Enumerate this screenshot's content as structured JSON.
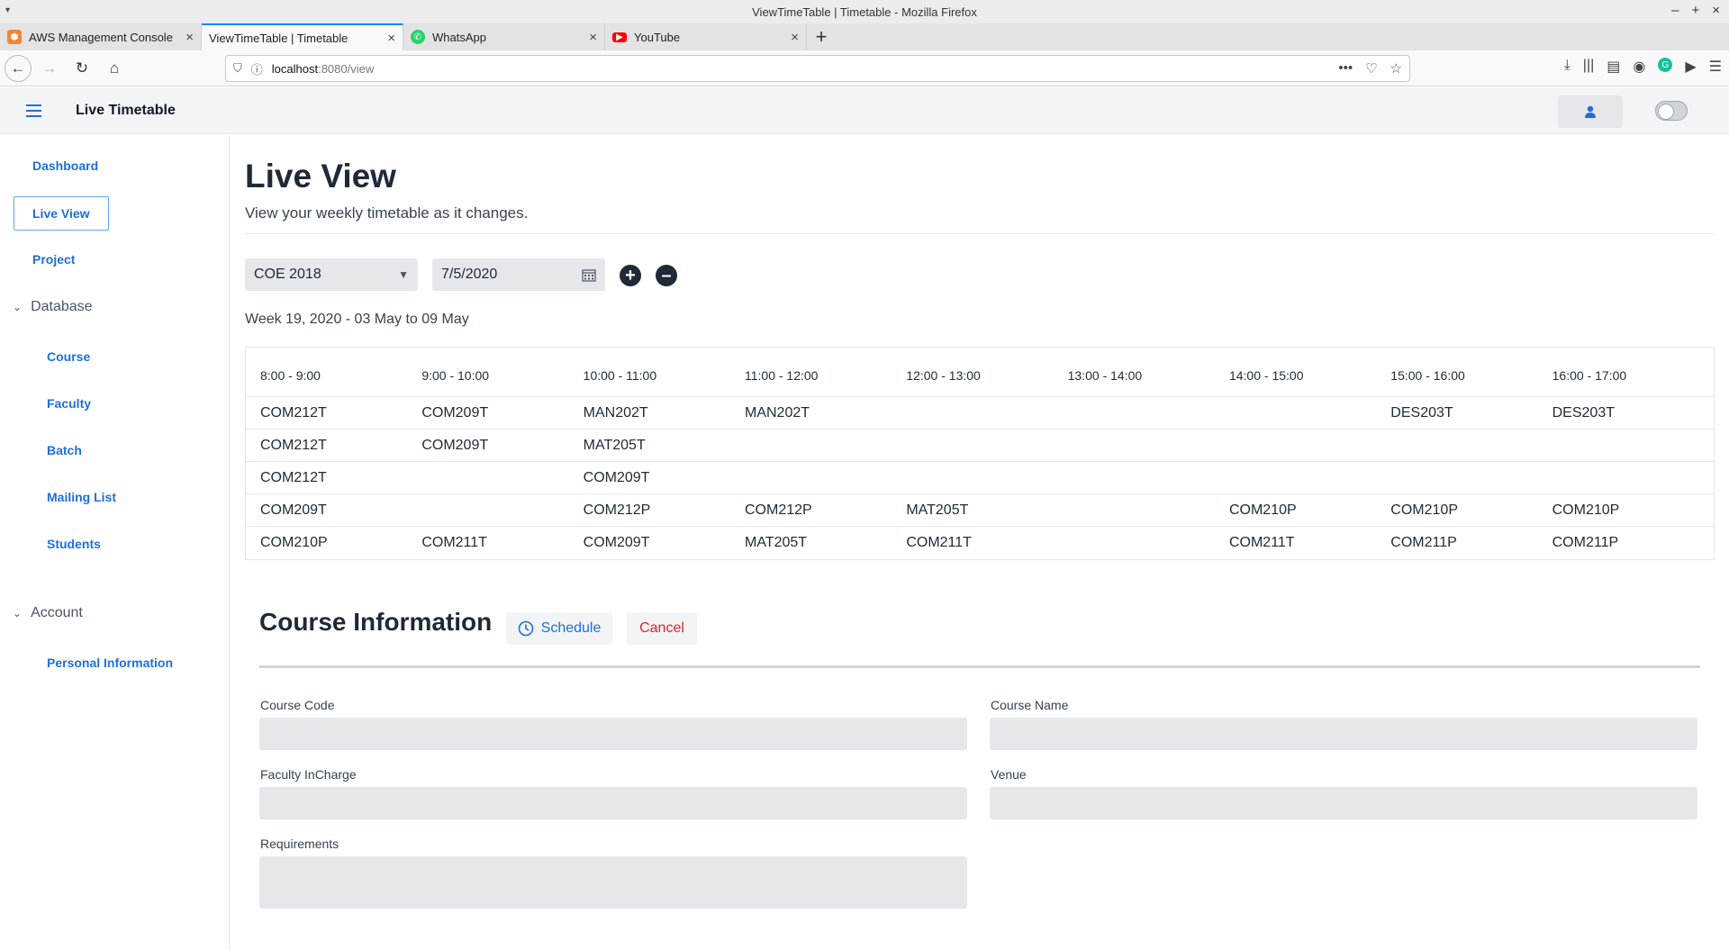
{
  "window": {
    "title": "ViewTimeTable | Timetable - Mozilla Firefox"
  },
  "tabs": [
    {
      "label": "AWS Management Console",
      "icon": "aws-icon",
      "color": "#f58536"
    },
    {
      "label": "ViewTimeTable | Timetable",
      "icon": "page-icon",
      "active": true
    },
    {
      "label": "WhatsApp",
      "icon": "whatsapp-icon",
      "color": "#25d366"
    },
    {
      "label": "YouTube",
      "icon": "youtube-icon",
      "color": "#ff0000"
    }
  ],
  "urlbar": {
    "host": "localhost",
    "path": ":8080/view"
  },
  "app": {
    "title": "Live Timetable",
    "accent": "#1e6fd9"
  },
  "sidebar": {
    "dashboard": "Dashboard",
    "live_view": "Live View",
    "project": "Project",
    "database_group": "Database",
    "database_items": [
      "Course",
      "Faculty",
      "Batch",
      "Mailing List",
      "Students"
    ],
    "account_group": "Account",
    "account_items": [
      "Personal Information"
    ]
  },
  "page": {
    "title": "Live View",
    "subtitle": "View your weekly timetable as it changes."
  },
  "filters": {
    "batch_selected": "COE 2018",
    "date_value": "7/5/2020"
  },
  "week_label": "Week 19, 2020 - 03 May to 09 May",
  "timetable": {
    "headers": [
      "8:00 - 9:00",
      "9:00 - 10:00",
      "10:00 - 11:00",
      "11:00 - 12:00",
      "12:00 - 13:00",
      "13:00 - 14:00",
      "14:00 - 15:00",
      "15:00 - 16:00",
      "16:00 - 17:00"
    ],
    "rows": [
      [
        "COM212T",
        "COM209T",
        "MAN202T",
        "MAN202T",
        "",
        "",
        "",
        "DES203T",
        "DES203T"
      ],
      [
        "COM212T",
        "COM209T",
        "MAT205T",
        "",
        "",
        "",
        "",
        "",
        ""
      ],
      [
        "COM212T",
        "",
        "COM209T",
        "",
        "",
        "",
        "",
        "",
        ""
      ],
      [
        "COM209T",
        "",
        "COM212P",
        "COM212P",
        "MAT205T",
        "",
        "COM210P",
        "COM210P",
        "COM210P"
      ],
      [
        "COM210P",
        "COM211T",
        "COM209T",
        "MAT205T",
        "COM211T",
        "",
        "COM211T",
        "COM211P",
        "COM211P"
      ]
    ]
  },
  "course_info": {
    "title": "Course Information",
    "schedule_label": "Schedule",
    "cancel_label": "Cancel",
    "fields": {
      "course_code": "Course Code",
      "course_name": "Course Name",
      "faculty_incharge": "Faculty InCharge",
      "venue": "Venue",
      "requirements": "Requirements"
    }
  }
}
